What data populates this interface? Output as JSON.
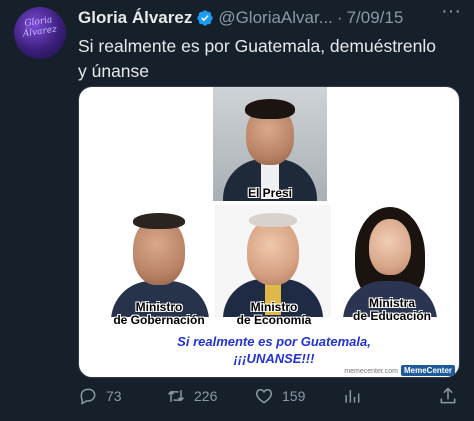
{
  "tweet": {
    "author": {
      "display_name": "Gloria Álvarez",
      "handle": "@GloriaAlvar...",
      "verified": true,
      "avatar_icon": "profile-avatar-icon"
    },
    "separator": "·",
    "date": "7/09/15",
    "more_icon": "more-options-icon",
    "text_line1": "Si realmente es por Guatemala, demuéstrenlo",
    "text_line2": "y únanse",
    "media": {
      "captions": {
        "presi": "El Presi",
        "gobernacion_1": "Ministro",
        "gobernacion_2": "de Gobernación",
        "economia_1": "Ministro",
        "economia_2": "de Economía",
        "educacion_1": "Ministra",
        "educacion_2": "de Educación"
      },
      "slogan_line1": "Si realmente es por Guatemala,",
      "slogan_line2": "¡¡¡UNANSE!!!",
      "watermark": "memecenter.com",
      "watermark_badge": "MemeCenter"
    },
    "actions": {
      "replies": "73",
      "retweets": "226",
      "likes": "159"
    },
    "colors": {
      "background": "#15202b",
      "text": "#e7e9ea",
      "secondary": "#8b98a5",
      "verified": "#1d9bf0",
      "slogan": "#2233d6"
    }
  }
}
